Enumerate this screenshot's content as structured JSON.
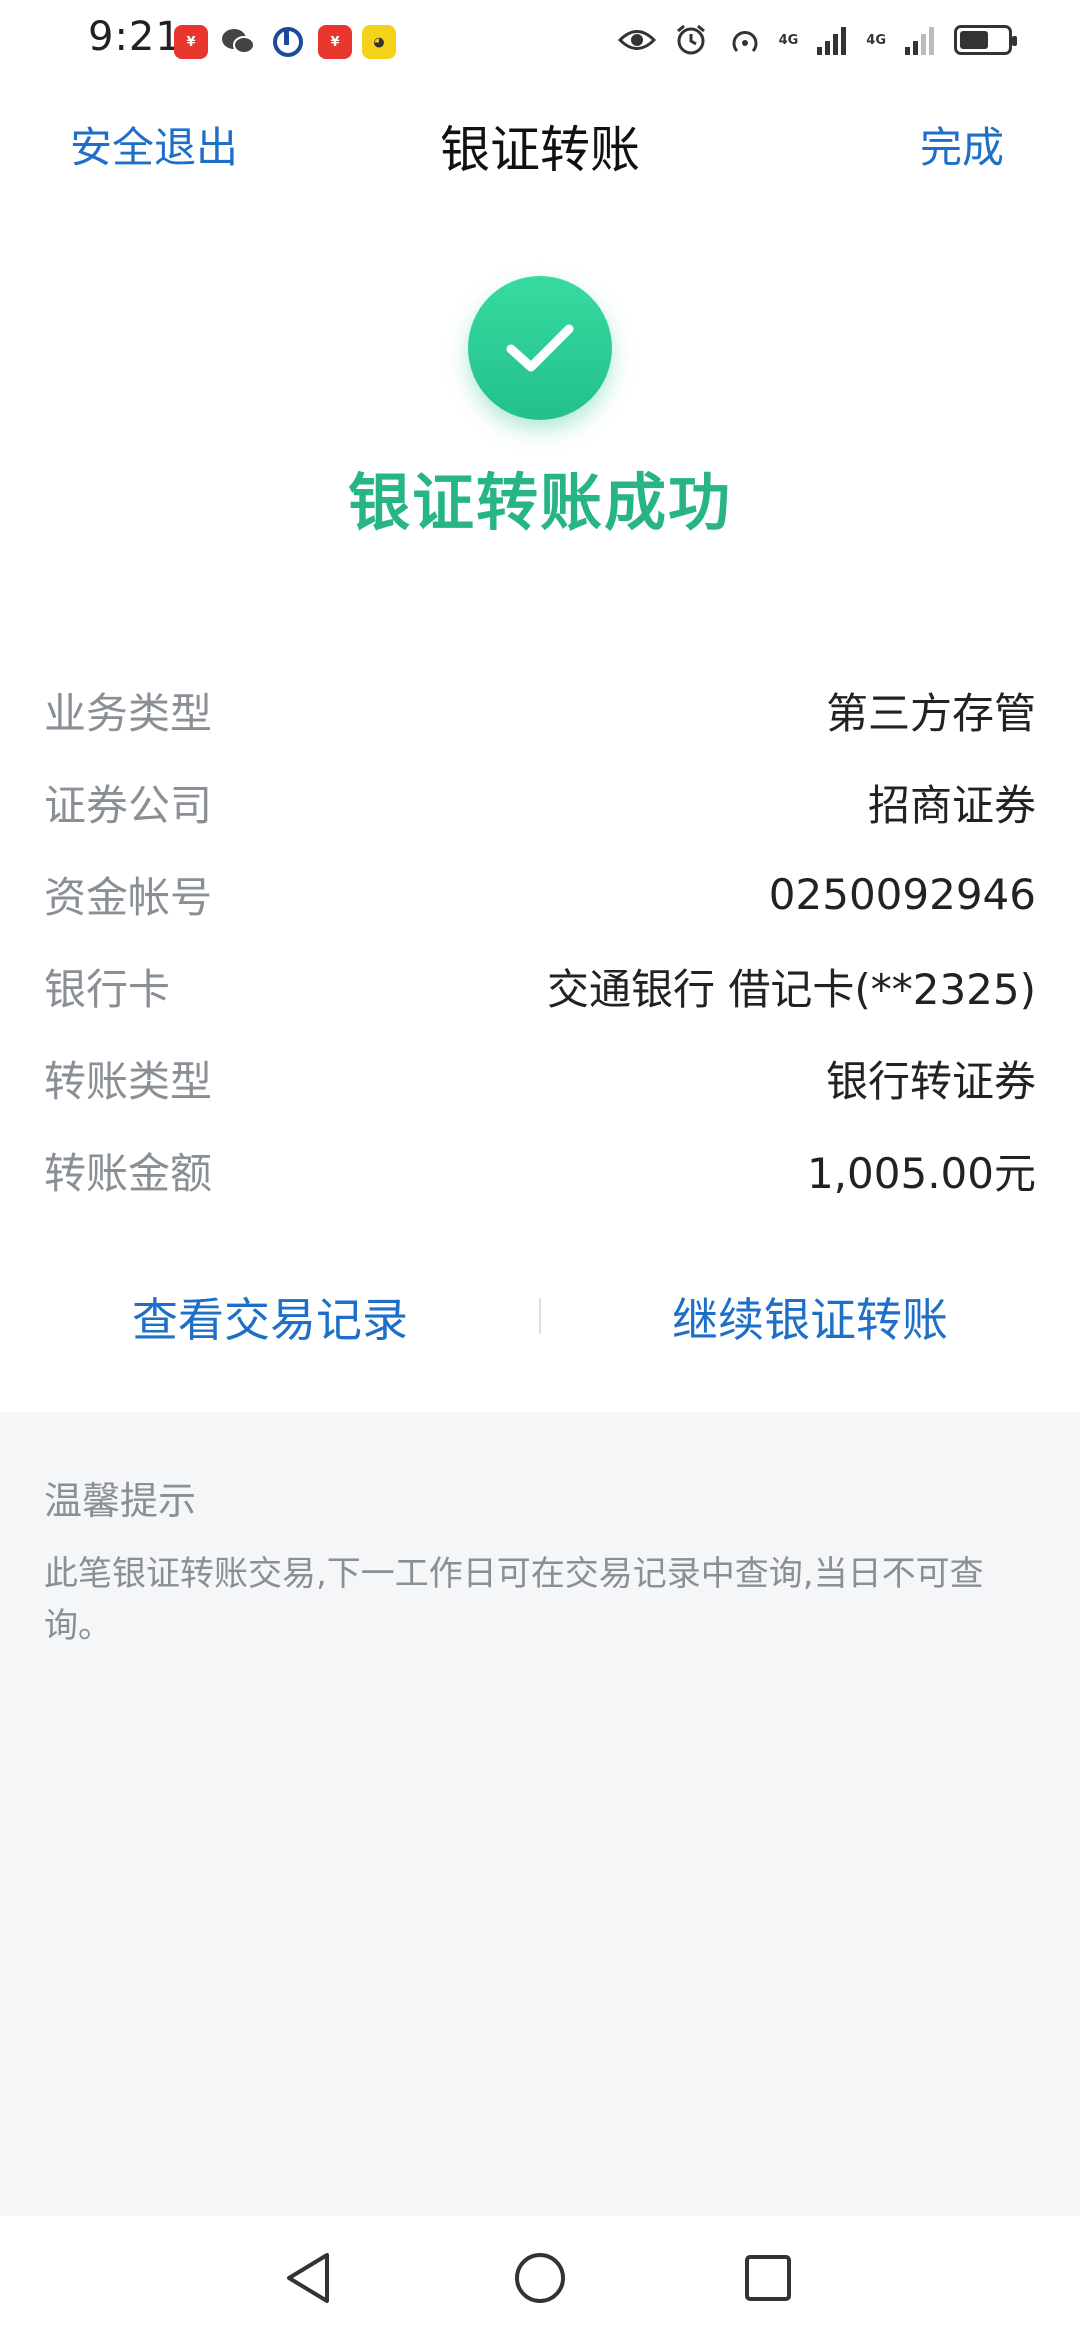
{
  "status": {
    "time": "9:21",
    "net1": "4G",
    "net2": "4G",
    "battery_level": 0.6
  },
  "header": {
    "left_label": "安全退出",
    "title": "银证转账",
    "right_label": "完成"
  },
  "result": {
    "message": "银证转账成功",
    "accent_color": "#27b583"
  },
  "details": [
    {
      "label": "业务类型",
      "value": "第三方存管"
    },
    {
      "label": "证券公司",
      "value": "招商证券"
    },
    {
      "label": "资金帐号",
      "value": "0250092946"
    },
    {
      "label": "银行卡",
      "value": "交通银行 借记卡(**2325)"
    },
    {
      "label": "转账类型",
      "value": "银行转证券"
    },
    {
      "label": "转账金额",
      "value": "1,005.00元"
    }
  ],
  "actions": {
    "view_records": "查看交易记录",
    "continue_transfer": "继续银证转账"
  },
  "tips": {
    "title": "温馨提示",
    "body": "此笔银证转账交易,下一工作日可在交易记录中查询,当日不可查询。"
  }
}
